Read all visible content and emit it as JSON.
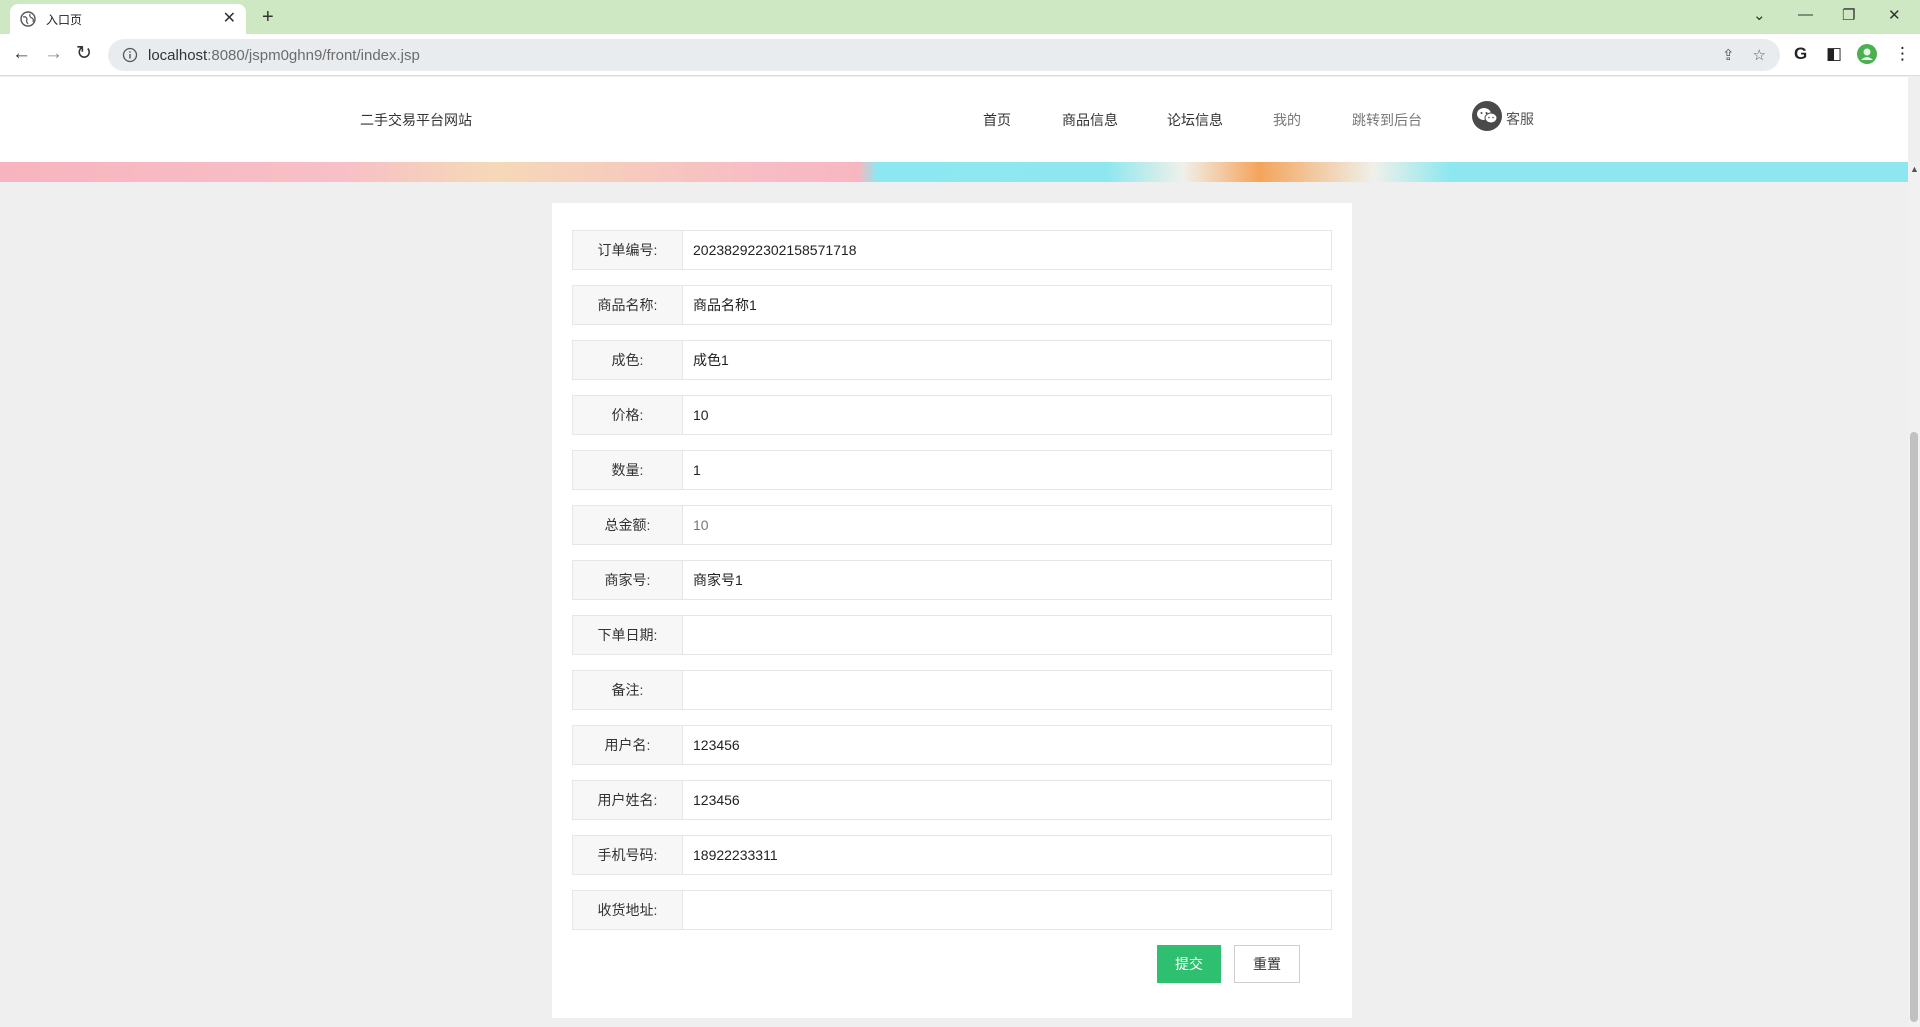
{
  "browser": {
    "tab_title": "入口页",
    "new_tab": "+",
    "url_host": "localhost",
    "url_rest": ":8080/jspm0ghn9/front/index.jsp"
  },
  "site": {
    "title": "二手交易平台网站",
    "nav": [
      "首页",
      "商品信息",
      "论坛信息",
      "我的",
      "跳转到后台"
    ],
    "service_label": "客服"
  },
  "form": {
    "fields": [
      {
        "label": "订单编号:",
        "value": "202382922302158571718"
      },
      {
        "label": "商品名称:",
        "value": "商品名称1"
      },
      {
        "label": "成色:",
        "value": "成色1"
      },
      {
        "label": "价格:",
        "value": "10"
      },
      {
        "label": "数量:",
        "value": "1"
      },
      {
        "label": "总金额:",
        "value": "10"
      },
      {
        "label": "商家号:",
        "value": "商家号1"
      },
      {
        "label": "下单日期:",
        "value": ""
      },
      {
        "label": "备注:",
        "value": ""
      },
      {
        "label": "用户名:",
        "value": "123456"
      },
      {
        "label": "用户姓名:",
        "value": "123456"
      },
      {
        "label": "手机号码:",
        "value": "18922233311"
      },
      {
        "label": "收货地址:",
        "value": ""
      }
    ],
    "submit_label": "提交",
    "reset_label": "重置"
  },
  "colors": {
    "tabbar_bg": "#cde8c3",
    "submit_bg": "#2fbf71"
  }
}
